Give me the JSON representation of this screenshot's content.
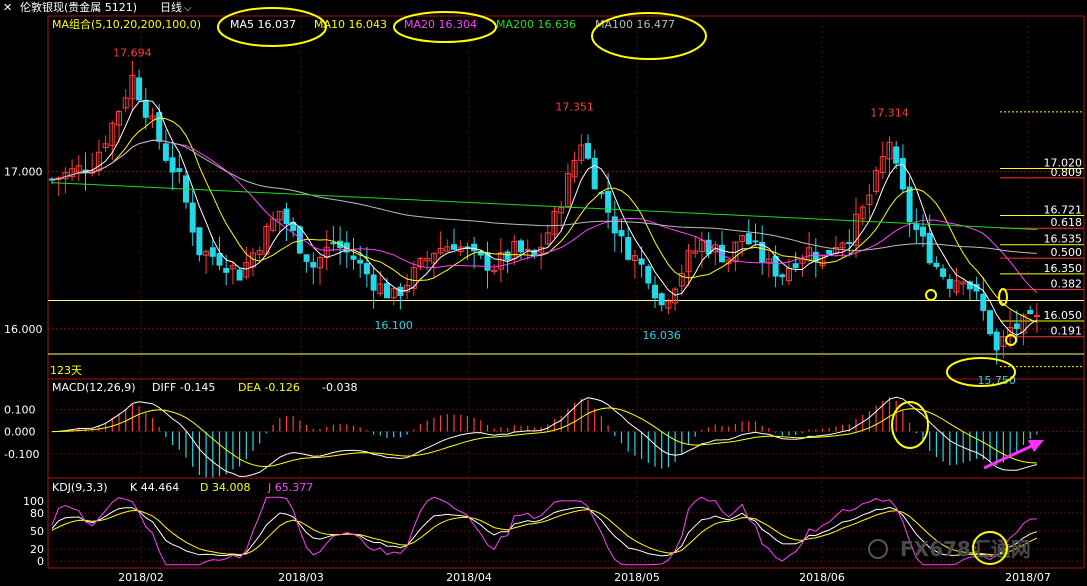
{
  "header": {
    "instrument": "伦敦银现(贵金属 5121)",
    "period": "日线"
  },
  "colors": {
    "up": "#ff3b3b",
    "down": "#22d8e8",
    "ma5": "#ffffff",
    "ma10": "#ffff00",
    "ma20": "#ff40ff",
    "ma200": "#22dd22",
    "ma100": "#bbbbbb",
    "diff": "#ffffff",
    "dea": "#ffff00",
    "k": "#ffffff",
    "d": "#ffff00",
    "j": "#ff40ff",
    "annotation": "#ffff00",
    "arrow": "#ff30ff"
  },
  "chart_data": [
    {
      "type": "candlestick",
      "panel": "price",
      "indicator_label": "MA组合(5,10,20,200,100,0)",
      "legend": [
        {
          "name": "MA5",
          "value": "16.037"
        },
        {
          "name": "MA10",
          "value": "16.043"
        },
        {
          "name": "MA20",
          "value": "16.304"
        },
        {
          "name": "MA200",
          "value": "16.636"
        },
        {
          "name": "MA100",
          "value": "16.477"
        }
      ],
      "y_ticks": [
        "17.000",
        "16.000"
      ],
      "x_ticks": [
        "2018/02",
        "2018/03",
        "2018/04",
        "2018/05",
        "2018/06",
        "2018/07"
      ],
      "ylim": [
        15.7,
        17.85
      ],
      "peak_labels": [
        {
          "label": "17.694",
          "date_index": 12,
          "value": 17.694
        },
        {
          "label": "17.351",
          "date_index": 78,
          "value": 17.351
        },
        {
          "label": "16.100",
          "date_index": 51,
          "value": 16.1
        },
        {
          "label": "16.036",
          "date_index": 91,
          "value": 16.036
        },
        {
          "label": "17.314",
          "date_index": 125,
          "value": 17.314
        },
        {
          "label": "15.750",
          "date_index": 141,
          "value": 15.75
        }
      ],
      "fib_levels": [
        {
          "label": "17.020",
          "value": 17.02
        },
        {
          "label": "0.809",
          "value": 16.96
        },
        {
          "label": "16.721",
          "value": 16.721
        },
        {
          "label": "0.618",
          "value": 16.64
        },
        {
          "label": "16.535",
          "value": 16.535
        },
        {
          "label": "0.500",
          "value": 16.45
        },
        {
          "label": "16.350",
          "value": 16.35
        },
        {
          "label": "0.382",
          "value": 16.25
        },
        {
          "label": "16.050",
          "value": 16.05
        },
        {
          "label": "0.191",
          "value": 15.95
        }
      ],
      "horizontal_lines": [
        16.18,
        15.84
      ],
      "days_label": "123天"
    },
    {
      "type": "bar",
      "panel": "macd",
      "indicator_label": "MACD(12,26,9)",
      "legend": [
        {
          "name": "DIFF",
          "value": "-0.145"
        },
        {
          "name": "DEA",
          "value": "-0.126"
        },
        {
          "name": "",
          "value": "-0.038"
        }
      ],
      "y_ticks": [
        "0.100",
        "0.000",
        "-0.100"
      ],
      "ylim": [
        -0.2,
        0.16
      ]
    },
    {
      "type": "line",
      "panel": "kdj",
      "indicator_label": "KDJ(9,3,3)",
      "legend": [
        {
          "name": "K",
          "value": "44.464"
        },
        {
          "name": "D",
          "value": "34.008"
        },
        {
          "name": "J",
          "value": "65.377"
        }
      ],
      "y_ticks": [
        "100",
        "80",
        "50",
        "20",
        "0"
      ],
      "ylim": [
        -8,
        108
      ]
    }
  ],
  "watermark": "FX678汇通网"
}
